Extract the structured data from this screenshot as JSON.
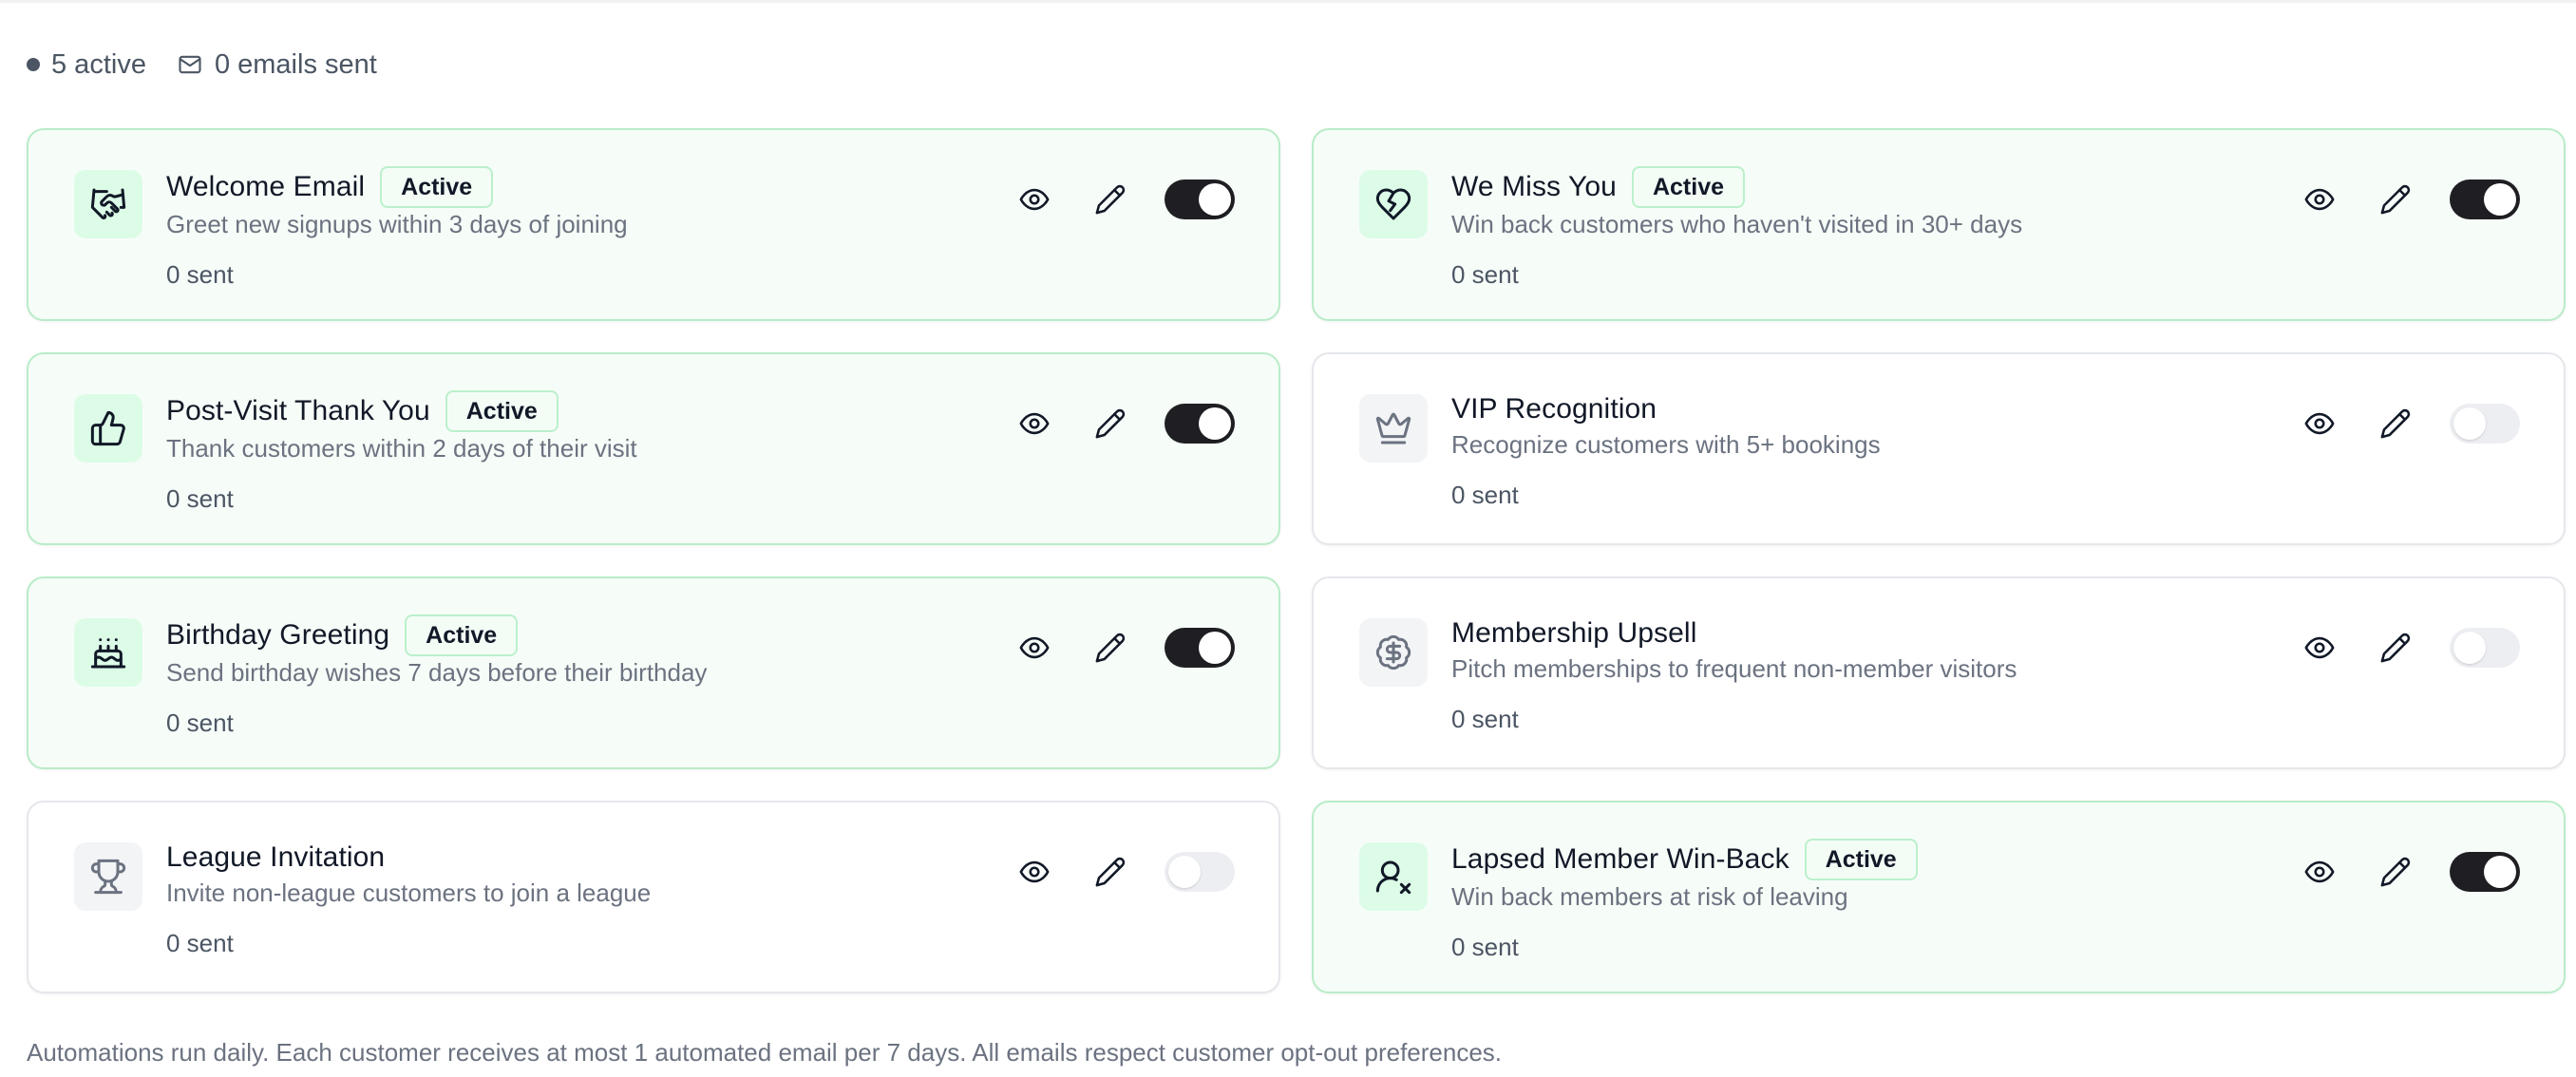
{
  "summary": {
    "active_text": "5 active",
    "emails_text": "0 emails sent"
  },
  "cards": [
    {
      "title": "Welcome Email",
      "badge": "Active",
      "description": "Greet new signups within 3 days of joining",
      "sent": "0 sent",
      "active": true,
      "icon": "handshake-icon"
    },
    {
      "title": "We Miss You",
      "badge": "Active",
      "description": "Win back customers who haven't visited in 30+ days",
      "sent": "0 sent",
      "active": true,
      "icon": "heart-crack-icon"
    },
    {
      "title": "Post-Visit Thank You",
      "badge": "Active",
      "description": "Thank customers within 2 days of their visit",
      "sent": "0 sent",
      "active": true,
      "icon": "thumbs-up-icon"
    },
    {
      "title": "VIP Recognition",
      "badge": "",
      "description": "Recognize customers with 5+ bookings",
      "sent": "0 sent",
      "active": false,
      "icon": "crown-icon"
    },
    {
      "title": "Birthday Greeting",
      "badge": "Active",
      "description": "Send birthday wishes 7 days before their birthday",
      "sent": "0 sent",
      "active": true,
      "icon": "cake-icon"
    },
    {
      "title": "Membership Upsell",
      "badge": "",
      "description": "Pitch memberships to frequent non-member visitors",
      "sent": "0 sent",
      "active": false,
      "icon": "dollar-badge-icon"
    },
    {
      "title": "League Invitation",
      "badge": "",
      "description": "Invite non-league customers to join a league",
      "sent": "0 sent",
      "active": false,
      "icon": "trophy-icon"
    },
    {
      "title": "Lapsed Member Win-Back",
      "badge": "Active",
      "description": "Win back members at risk of leaving",
      "sent": "0 sent",
      "active": true,
      "icon": "user-x-icon"
    }
  ],
  "footer": "Automations run daily. Each customer receives at most 1 automated email per 7 days. All emails respect customer opt-out preferences.",
  "colors": {
    "active_border": "#b9ecc8",
    "active_bg": "#f6fdf8",
    "toggle_on": "#1f1f23",
    "toggle_off": "#eceef1"
  }
}
